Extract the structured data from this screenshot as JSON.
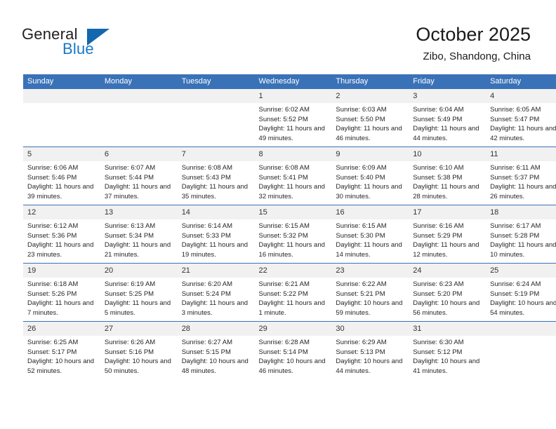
{
  "logo": {
    "word_one": "General",
    "word_two": "Blue",
    "triangle_color": "#1267ad",
    "blue_text_color": "#1878c8"
  },
  "header": {
    "title": "October 2025",
    "subtitle": "Zibo, Shandong, China"
  },
  "theme": {
    "header_blue": "#3a72b8",
    "daynum_background": "#f1f1f1",
    "cell_background": "#ffffff"
  },
  "calendar": {
    "weekday_headers": [
      "Sunday",
      "Monday",
      "Tuesday",
      "Wednesday",
      "Thursday",
      "Friday",
      "Saturday"
    ],
    "weeks": [
      [
        {
          "day": "",
          "empty": true
        },
        {
          "day": "",
          "empty": true
        },
        {
          "day": "",
          "empty": true
        },
        {
          "day": "1",
          "sunrise": "Sunrise: 6:02 AM",
          "sunset": "Sunset: 5:52 PM",
          "daylight": "Daylight: 11 hours and 49 minutes."
        },
        {
          "day": "2",
          "sunrise": "Sunrise: 6:03 AM",
          "sunset": "Sunset: 5:50 PM",
          "daylight": "Daylight: 11 hours and 46 minutes."
        },
        {
          "day": "3",
          "sunrise": "Sunrise: 6:04 AM",
          "sunset": "Sunset: 5:49 PM",
          "daylight": "Daylight: 11 hours and 44 minutes."
        },
        {
          "day": "4",
          "sunrise": "Sunrise: 6:05 AM",
          "sunset": "Sunset: 5:47 PM",
          "daylight": "Daylight: 11 hours and 42 minutes."
        }
      ],
      [
        {
          "day": "5",
          "sunrise": "Sunrise: 6:06 AM",
          "sunset": "Sunset: 5:46 PM",
          "daylight": "Daylight: 11 hours and 39 minutes."
        },
        {
          "day": "6",
          "sunrise": "Sunrise: 6:07 AM",
          "sunset": "Sunset: 5:44 PM",
          "daylight": "Daylight: 11 hours and 37 minutes."
        },
        {
          "day": "7",
          "sunrise": "Sunrise: 6:08 AM",
          "sunset": "Sunset: 5:43 PM",
          "daylight": "Daylight: 11 hours and 35 minutes."
        },
        {
          "day": "8",
          "sunrise": "Sunrise: 6:08 AM",
          "sunset": "Sunset: 5:41 PM",
          "daylight": "Daylight: 11 hours and 32 minutes."
        },
        {
          "day": "9",
          "sunrise": "Sunrise: 6:09 AM",
          "sunset": "Sunset: 5:40 PM",
          "daylight": "Daylight: 11 hours and 30 minutes."
        },
        {
          "day": "10",
          "sunrise": "Sunrise: 6:10 AM",
          "sunset": "Sunset: 5:38 PM",
          "daylight": "Daylight: 11 hours and 28 minutes."
        },
        {
          "day": "11",
          "sunrise": "Sunrise: 6:11 AM",
          "sunset": "Sunset: 5:37 PM",
          "daylight": "Daylight: 11 hours and 26 minutes."
        }
      ],
      [
        {
          "day": "12",
          "sunrise": "Sunrise: 6:12 AM",
          "sunset": "Sunset: 5:36 PM",
          "daylight": "Daylight: 11 hours and 23 minutes."
        },
        {
          "day": "13",
          "sunrise": "Sunrise: 6:13 AM",
          "sunset": "Sunset: 5:34 PM",
          "daylight": "Daylight: 11 hours and 21 minutes."
        },
        {
          "day": "14",
          "sunrise": "Sunrise: 6:14 AM",
          "sunset": "Sunset: 5:33 PM",
          "daylight": "Daylight: 11 hours and 19 minutes."
        },
        {
          "day": "15",
          "sunrise": "Sunrise: 6:15 AM",
          "sunset": "Sunset: 5:32 PM",
          "daylight": "Daylight: 11 hours and 16 minutes."
        },
        {
          "day": "16",
          "sunrise": "Sunrise: 6:15 AM",
          "sunset": "Sunset: 5:30 PM",
          "daylight": "Daylight: 11 hours and 14 minutes."
        },
        {
          "day": "17",
          "sunrise": "Sunrise: 6:16 AM",
          "sunset": "Sunset: 5:29 PM",
          "daylight": "Daylight: 11 hours and 12 minutes."
        },
        {
          "day": "18",
          "sunrise": "Sunrise: 6:17 AM",
          "sunset": "Sunset: 5:28 PM",
          "daylight": "Daylight: 11 hours and 10 minutes."
        }
      ],
      [
        {
          "day": "19",
          "sunrise": "Sunrise: 6:18 AM",
          "sunset": "Sunset: 5:26 PM",
          "daylight": "Daylight: 11 hours and 7 minutes."
        },
        {
          "day": "20",
          "sunrise": "Sunrise: 6:19 AM",
          "sunset": "Sunset: 5:25 PM",
          "daylight": "Daylight: 11 hours and 5 minutes."
        },
        {
          "day": "21",
          "sunrise": "Sunrise: 6:20 AM",
          "sunset": "Sunset: 5:24 PM",
          "daylight": "Daylight: 11 hours and 3 minutes."
        },
        {
          "day": "22",
          "sunrise": "Sunrise: 6:21 AM",
          "sunset": "Sunset: 5:22 PM",
          "daylight": "Daylight: 11 hours and 1 minute."
        },
        {
          "day": "23",
          "sunrise": "Sunrise: 6:22 AM",
          "sunset": "Sunset: 5:21 PM",
          "daylight": "Daylight: 10 hours and 59 minutes."
        },
        {
          "day": "24",
          "sunrise": "Sunrise: 6:23 AM",
          "sunset": "Sunset: 5:20 PM",
          "daylight": "Daylight: 10 hours and 56 minutes."
        },
        {
          "day": "25",
          "sunrise": "Sunrise: 6:24 AM",
          "sunset": "Sunset: 5:19 PM",
          "daylight": "Daylight: 10 hours and 54 minutes."
        }
      ],
      [
        {
          "day": "26",
          "sunrise": "Sunrise: 6:25 AM",
          "sunset": "Sunset: 5:17 PM",
          "daylight": "Daylight: 10 hours and 52 minutes."
        },
        {
          "day": "27",
          "sunrise": "Sunrise: 6:26 AM",
          "sunset": "Sunset: 5:16 PM",
          "daylight": "Daylight: 10 hours and 50 minutes."
        },
        {
          "day": "28",
          "sunrise": "Sunrise: 6:27 AM",
          "sunset": "Sunset: 5:15 PM",
          "daylight": "Daylight: 10 hours and 48 minutes."
        },
        {
          "day": "29",
          "sunrise": "Sunrise: 6:28 AM",
          "sunset": "Sunset: 5:14 PM",
          "daylight": "Daylight: 10 hours and 46 minutes."
        },
        {
          "day": "30",
          "sunrise": "Sunrise: 6:29 AM",
          "sunset": "Sunset: 5:13 PM",
          "daylight": "Daylight: 10 hours and 44 minutes."
        },
        {
          "day": "31",
          "sunrise": "Sunrise: 6:30 AM",
          "sunset": "Sunset: 5:12 PM",
          "daylight": "Daylight: 10 hours and 41 minutes."
        },
        {
          "day": "",
          "empty": true
        }
      ]
    ]
  }
}
